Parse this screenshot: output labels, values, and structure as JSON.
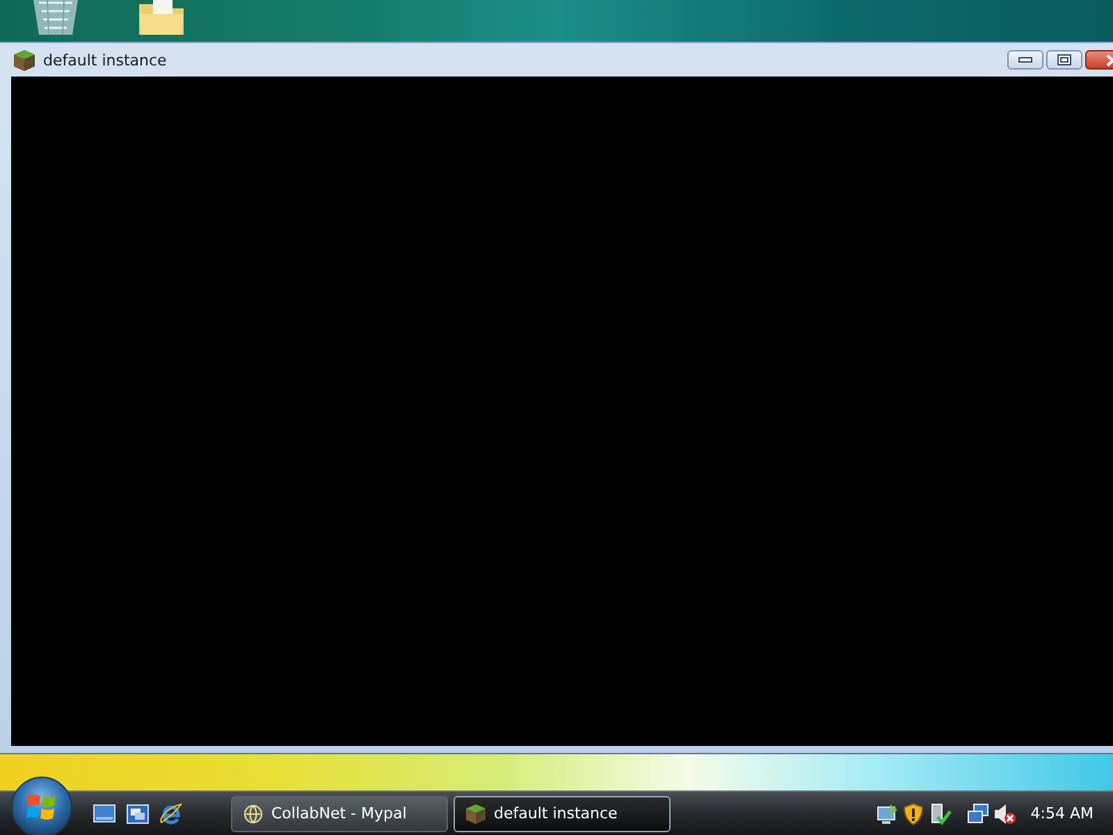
{
  "window": {
    "title": "default instance"
  },
  "taskbar": {
    "buttons": [
      {
        "label": "CollabNet - Mypal",
        "kind": "browser",
        "selected": false
      },
      {
        "label": "default instance",
        "kind": "cube",
        "selected": true
      }
    ],
    "clock": "4:54 AM"
  }
}
